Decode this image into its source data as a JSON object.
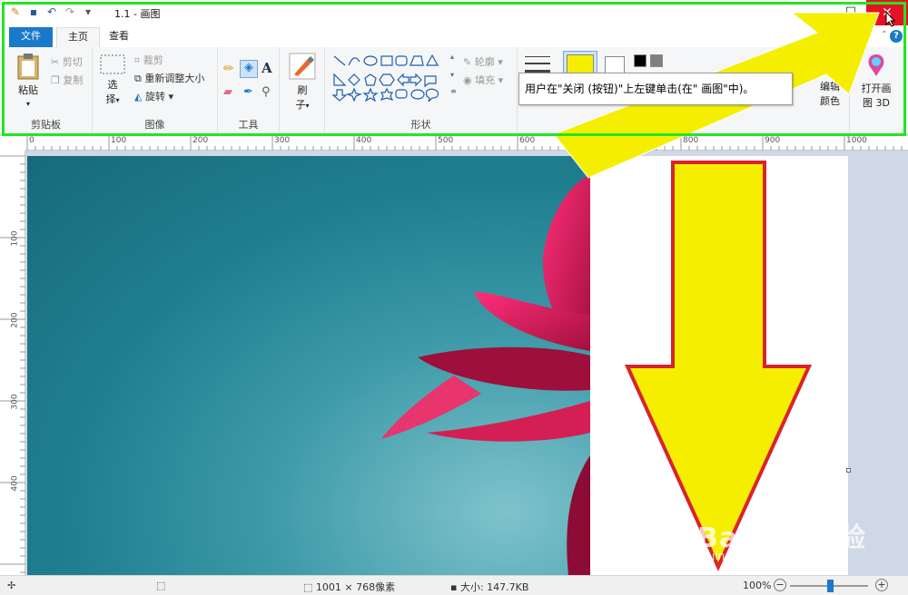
{
  "window": {
    "title": "1.1 - 画图",
    "minimize_glyph": "—",
    "maximize_glyph": "☐",
    "close_glyph": "✕"
  },
  "quick_access": {
    "icons": [
      "paint-app-icon",
      "save-icon",
      "undo-icon",
      "redo-icon",
      "customize-qat-icon"
    ]
  },
  "tabs": [
    {
      "label": "文件"
    },
    {
      "label": "主页"
    },
    {
      "label": "查看"
    }
  ],
  "ribbon": {
    "clipboard": {
      "paste_label": "粘贴",
      "cut_label": "剪切",
      "copy_label": "复制",
      "group_label": "剪贴板"
    },
    "image": {
      "select_label": "选",
      "select_label2": "择",
      "crop_label": "裁剪",
      "resize_label": "重新调整大小",
      "rotate_label": "旋转",
      "group_label": "图像"
    },
    "tools": {
      "group_label": "工具",
      "text_glyph": "A"
    },
    "brushes": {
      "label": "刷",
      "label2": "子"
    },
    "shapes": {
      "outline_label": "轮廓",
      "fill_label": "填充",
      "group_label": "形状"
    },
    "colors": {
      "edit_colors_label": "编辑",
      "edit_colors_label2": "颜色",
      "color1": "#f5ee00"
    },
    "paint3d": {
      "label": "打开画",
      "label2": "图 3D"
    }
  },
  "tooltip": {
    "text": "用户在\"关闭 (按钮)\"上左键单击(在\" 画图\"中)。"
  },
  "rulers": {
    "horizontal": [
      "0",
      "100",
      "200",
      "300",
      "400",
      "500",
      "600",
      "700",
      "800",
      "900",
      "1000"
    ],
    "vertical": [
      "100",
      "200",
      "300",
      "400"
    ]
  },
  "statusbar": {
    "dimensions": "1001 × 768像素",
    "size": "大小: 147.7KB",
    "zoom": "100%",
    "zoom_out": "−",
    "zoom_in": "+"
  },
  "watermark": {
    "brand": "Bai du 经验",
    "url": "jingyan.baidu.com"
  },
  "colors": {
    "accent": "#1979ca",
    "close": "#e81123",
    "highlight_frame": "#22e622",
    "arrow_fill": "#f5ee00",
    "arrow_stroke": "#d9232d"
  }
}
